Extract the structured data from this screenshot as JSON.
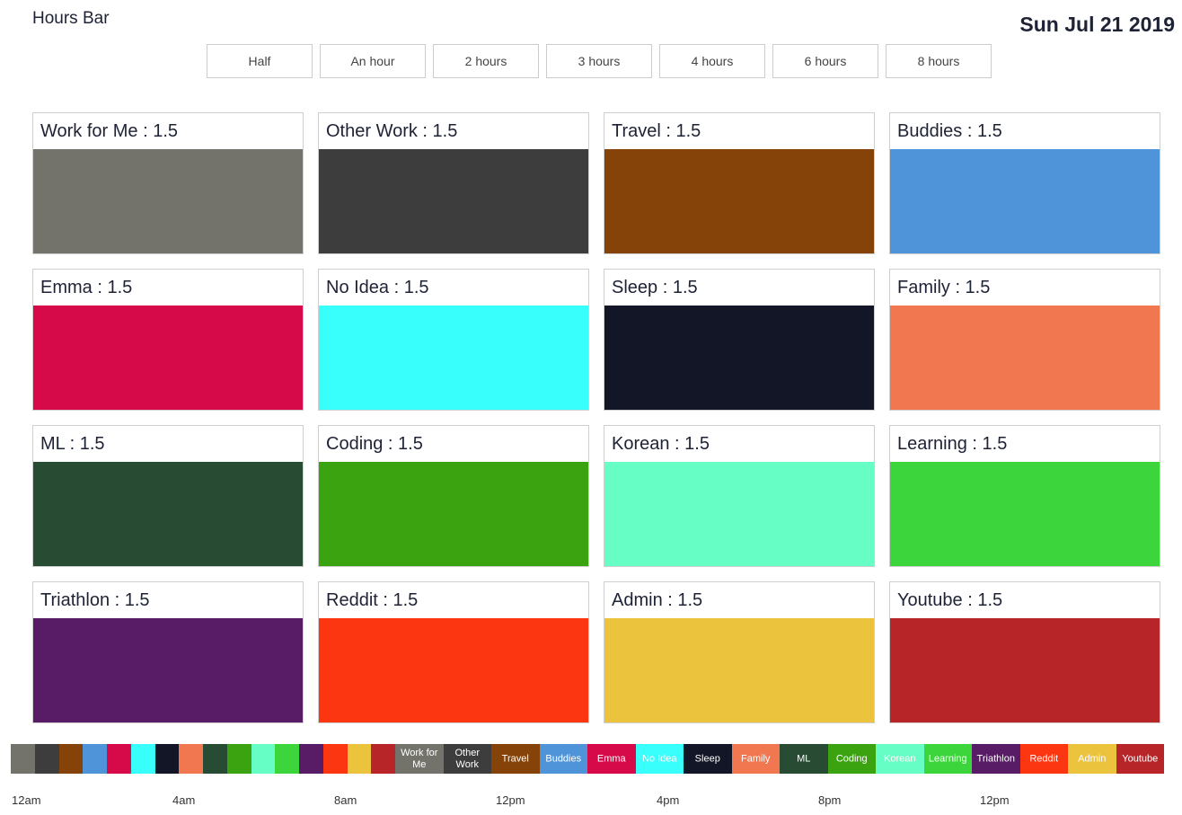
{
  "header": {
    "title": "Hours Bar",
    "date": "Sun Jul 21 2019"
  },
  "duration_buttons": [
    "Half",
    "An hour",
    "2 hours",
    "3 hours",
    "4 hours",
    "6 hours",
    "8 hours"
  ],
  "categories": [
    {
      "label": "Work for Me : 1.5",
      "color": "#73736c"
    },
    {
      "label": "Other Work : 1.5",
      "color": "#3d3d3d"
    },
    {
      "label": "Travel : 1.5",
      "color": "#85430a"
    },
    {
      "label": "Buddies : 1.5",
      "color": "#4f94d9"
    },
    {
      "label": "Emma : 1.5",
      "color": "#d60a48"
    },
    {
      "label": "No Idea : 1.5",
      "color": "#38fffc"
    },
    {
      "label": "Sleep : 1.5",
      "color": "#131627"
    },
    {
      "label": "Family : 1.5",
      "color": "#f07750"
    },
    {
      "label": "ML : 1.5",
      "color": "#284b33"
    },
    {
      "label": "Coding : 1.5",
      "color": "#3ba310"
    },
    {
      "label": "Korean : 1.5",
      "color": "#66fec4"
    },
    {
      "label": "Learning : 1.5",
      "color": "#3cd53c"
    },
    {
      "label": "Triathlon : 1.5",
      "color": "#581c66"
    },
    {
      "label": "Reddit : 1.5",
      "color": "#fb3611"
    },
    {
      "label": "Admin : 1.5",
      "color": "#ecc33d"
    },
    {
      "label": "Youtube : 1.5",
      "color": "#b82529"
    }
  ],
  "timeline": {
    "segments": [
      {
        "color": "#73736c"
      },
      {
        "color": "#3d3d3d"
      },
      {
        "color": "#85430a"
      },
      {
        "color": "#4f94d9"
      },
      {
        "color": "#d60a48"
      },
      {
        "color": "#38fffc"
      },
      {
        "color": "#131627"
      },
      {
        "color": "#f07750"
      },
      {
        "color": "#284b33"
      },
      {
        "color": "#3ba310"
      },
      {
        "color": "#66fec4"
      },
      {
        "color": "#3cd53c"
      },
      {
        "color": "#581c66"
      },
      {
        "color": "#fb3611"
      },
      {
        "color": "#ecc33d"
      },
      {
        "color": "#b82529"
      },
      {
        "label": "Work for Me",
        "color": "#73736c"
      },
      {
        "label": "Other Work",
        "color": "#3d3d3d"
      },
      {
        "label": "Travel",
        "color": "#85430a"
      },
      {
        "label": "Buddies",
        "color": "#4f94d9"
      },
      {
        "label": "Emma",
        "color": "#d60a48"
      },
      {
        "label": "No Idea",
        "color": "#38fffc"
      },
      {
        "label": "Sleep",
        "color": "#131627"
      },
      {
        "label": "Family",
        "color": "#f07750"
      },
      {
        "label": "ML",
        "color": "#284b33"
      },
      {
        "label": "Coding",
        "color": "#3ba310"
      },
      {
        "label": "Korean",
        "color": "#66fec4"
      },
      {
        "label": "Learning",
        "color": "#3cd53c"
      },
      {
        "label": "Triathlon",
        "color": "#581c66"
      },
      {
        "label": "Reddit",
        "color": "#fb3611"
      },
      {
        "label": "Admin",
        "color": "#ecc33d"
      },
      {
        "label": "Youtube",
        "color": "#b82529"
      }
    ],
    "time_labels": [
      "12am",
      "4am",
      "8am",
      "12pm",
      "4pm",
      "8pm",
      "12pm"
    ]
  }
}
